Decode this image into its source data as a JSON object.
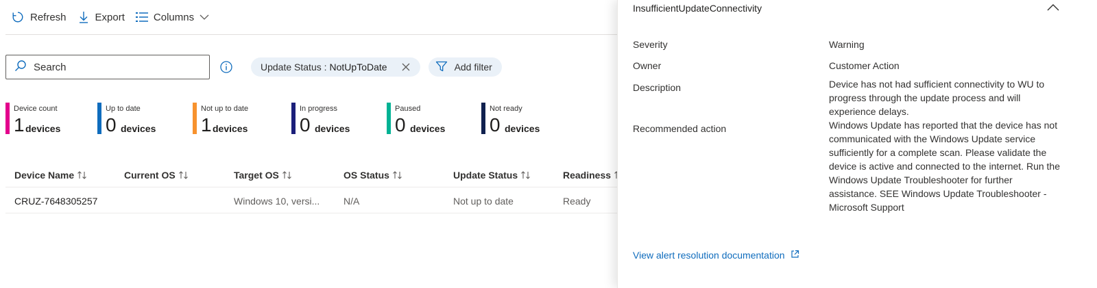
{
  "toolbar": {
    "refresh_label": "Refresh",
    "export_label": "Export",
    "columns_label": "Columns"
  },
  "search": {
    "placeholder": "Search"
  },
  "filters": {
    "status_key": "Update Status :",
    "status_value": "NotUpToDate",
    "add_label": "Add filter"
  },
  "stats": [
    {
      "label": "Device count",
      "number": "1",
      "unit": "devices",
      "color": "#e3008c"
    },
    {
      "label": "Up to date",
      "number": "0",
      "unit": "devices",
      "color": "#0f6cbd"
    },
    {
      "label": "Not up to date",
      "number": "1",
      "unit": "devices",
      "color": "#f7922e"
    },
    {
      "label": "In progress",
      "number": "0",
      "unit": "devices",
      "color": "#1b1f7a"
    },
    {
      "label": "Paused",
      "number": "0",
      "unit": "devices",
      "color": "#00b294"
    },
    {
      "label": "Not ready",
      "number": "0",
      "unit": "devices",
      "color": "#10214f"
    }
  ],
  "table": {
    "columns": [
      "Device Name",
      "Current OS",
      "Target OS",
      "OS Status",
      "Update Status",
      "Readiness"
    ],
    "rows": [
      [
        "CRUZ-7648305257",
        "",
        "Windows 10, versi...",
        "N/A",
        "Not up to date",
        "Ready"
      ]
    ]
  },
  "panel": {
    "title": "InsufficientUpdateConnectivity",
    "severity_label": "Severity",
    "severity_value": "Warning",
    "owner_label": "Owner",
    "owner_value": "Customer Action",
    "description_label": "Description",
    "description_value": "Device has not had sufficient connectivity to WU to progress through the update process and will experience delays.",
    "action_label": "Recommended action",
    "action_value": "Windows Update has reported that the device has not communicated with the Windows Update service sufficiently for a complete scan. Please validate the device is active and connected to the internet. Run the Windows Update Troubleshooter for further assistance. SEE Windows Update Troubleshooter - Microsoft Support",
    "doc_link": "View alert resolution documentation"
  },
  "colors": {
    "accent": "#0f6cbd",
    "pill_bg": "#eaf1f8"
  }
}
